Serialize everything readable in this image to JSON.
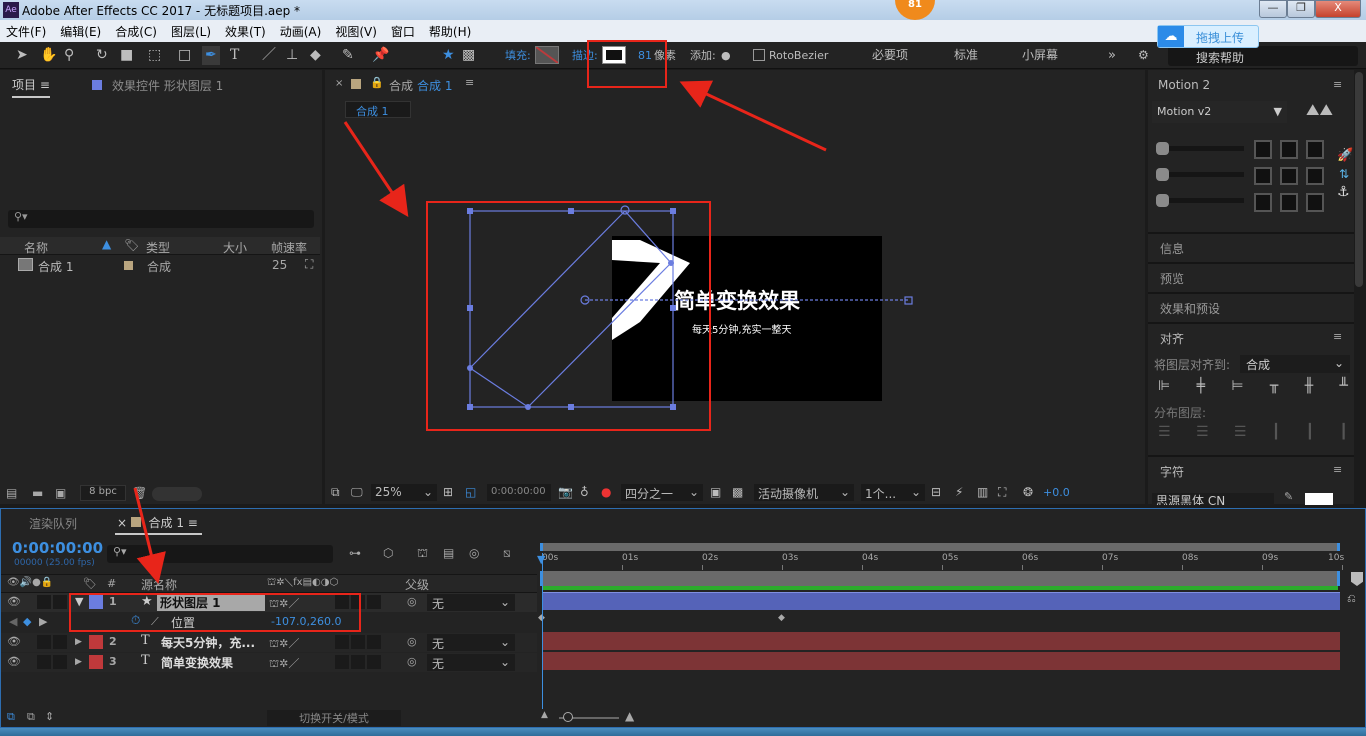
{
  "window": {
    "title": "Adobe After Effects CC 2017 - 无标题项目.aep *",
    "badge": "81",
    "app_icon": "Ae"
  },
  "menu": [
    "文件(F)",
    "编辑(E)",
    "合成(C)",
    "图层(L)",
    "效果(T)",
    "动画(A)",
    "视图(V)",
    "窗口",
    "帮助(H)"
  ],
  "toolbar": {
    "fill_label": "填充:",
    "stroke_label": "描边:",
    "stroke_width": "81",
    "stroke_unit": "像素",
    "add_label": "添加:",
    "rotobezier": "RotoBezier",
    "workspaces": [
      "必要项",
      "标准",
      "小屏幕"
    ],
    "more": "»",
    "search_placeholder": "搜索帮助",
    "upload_label": "拖拽上传"
  },
  "project": {
    "tab": "项目",
    "effects_tab": "效果控件 形状图层 1",
    "columns": [
      "名称",
      "类型",
      "大小",
      "帧速率"
    ],
    "items": [
      {
        "name": "合成 1",
        "type": "合成",
        "fps": "25"
      }
    ],
    "bpc": "8 bpc"
  },
  "viewer": {
    "tab_prefix": "合成",
    "tab_name": "合成 1",
    "subtab": "合成 1",
    "title_text": "简单变换效果",
    "subtitle_text": "每天5分钟,充实一整天",
    "zoom": "25%",
    "timecode": "0:00:00:00",
    "resolution": "四分之一",
    "camera": "活动摄像机",
    "views": "1个...",
    "exposure": "+0.0"
  },
  "right": {
    "motion_title": "Motion 2",
    "motion_version": "Motion v2",
    "info": "信息",
    "preview": "预览",
    "effects_presets": "效果和预设",
    "align": "对齐",
    "align_to_label": "将图层对齐到:",
    "align_to_value": "合成",
    "distribute_label": "分布图层:",
    "character": "字符",
    "font_value": "思源黑体 CN"
  },
  "timeline": {
    "render_tab": "渲染队列",
    "comp_tab": "合成 1",
    "timecode": "0:00:00:00",
    "frame_info": "00000 (25.00 fps)",
    "col_source": "源名称",
    "col_parent": "父级",
    "switch_label": "切换开关/模式",
    "ruler": [
      "00s",
      "01s",
      "02s",
      "03s",
      "04s",
      "05s",
      "06s",
      "07s",
      "08s",
      "09s",
      "10s"
    ],
    "layers": [
      {
        "num": "1",
        "type": "★",
        "name": "形状图层 1",
        "color": "#6b7de0",
        "parent": "无",
        "expanded": true
      },
      {
        "num": "2",
        "type": "T",
        "name": "每天5分钟，充...",
        "color": "#c0393b",
        "parent": "无"
      },
      {
        "num": "3",
        "type": "T",
        "name": "简单变换效果",
        "color": "#c0393b",
        "parent": "无"
      }
    ],
    "property": {
      "name": "位置",
      "value": "-107.0,260.0",
      "keyframes_s": [
        0,
        3
      ]
    }
  },
  "colors": {
    "accent": "#3d8fe0",
    "annotation": "#e8251a",
    "shape_layer": "#6b7de0",
    "text_layer": "#c0393b"
  }
}
